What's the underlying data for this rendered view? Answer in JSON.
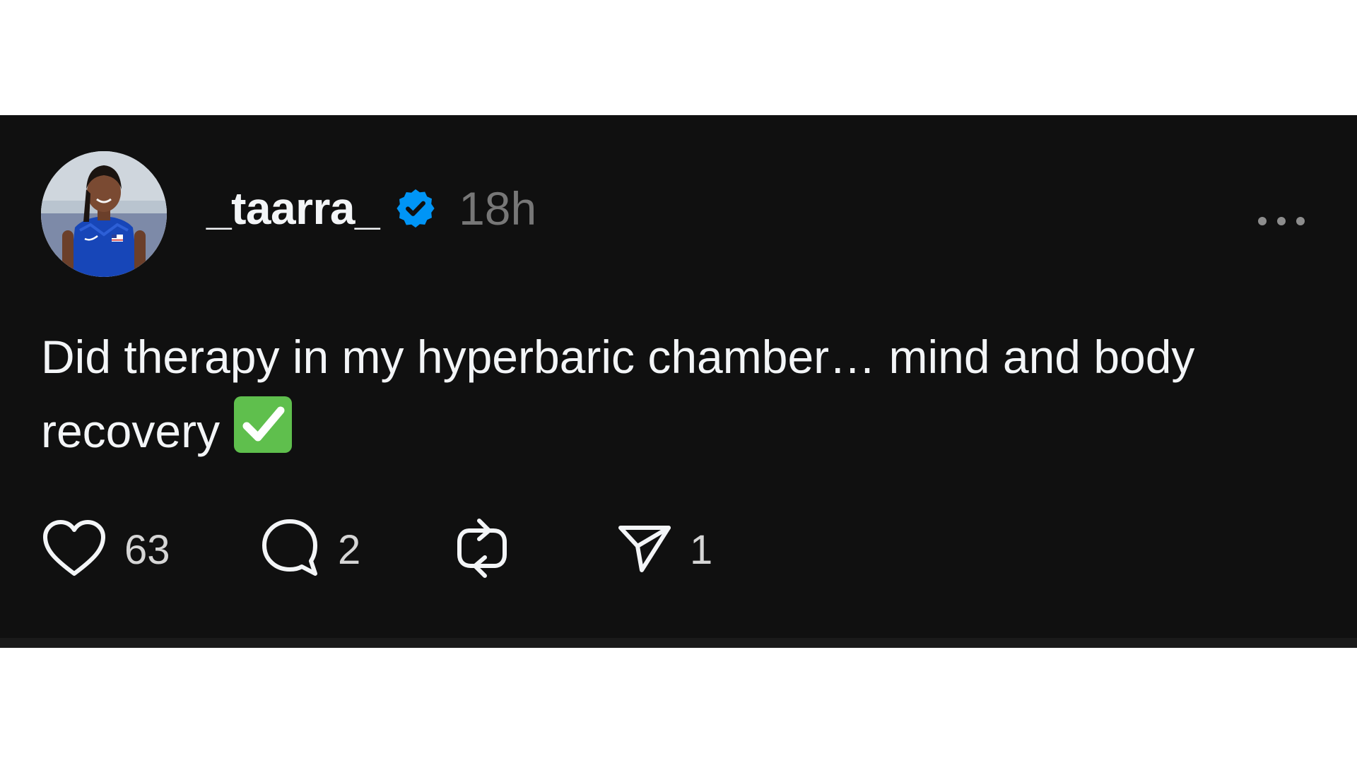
{
  "post": {
    "username": "_taarra_",
    "timestamp": "18h",
    "verified": true,
    "text_line1": "Did therapy in my hyperbaric chamber… mind and body",
    "text_line2": "recovery",
    "emoji": "white-heavy-check-mark",
    "avatar_icon": "profile-photo",
    "actions": {
      "like": {
        "icon": "heart-icon",
        "count": "63"
      },
      "reply": {
        "icon": "speech-bubble-icon",
        "count": "2"
      },
      "repost": {
        "icon": "repost-icon",
        "count": ""
      },
      "share": {
        "icon": "paper-plane-icon",
        "count": "1"
      }
    }
  },
  "colors": {
    "background": "#101010",
    "text": "#f3f5f7",
    "muted": "#777777",
    "verified_blue": "#0095f6",
    "check_green": "#5fbf4d"
  }
}
